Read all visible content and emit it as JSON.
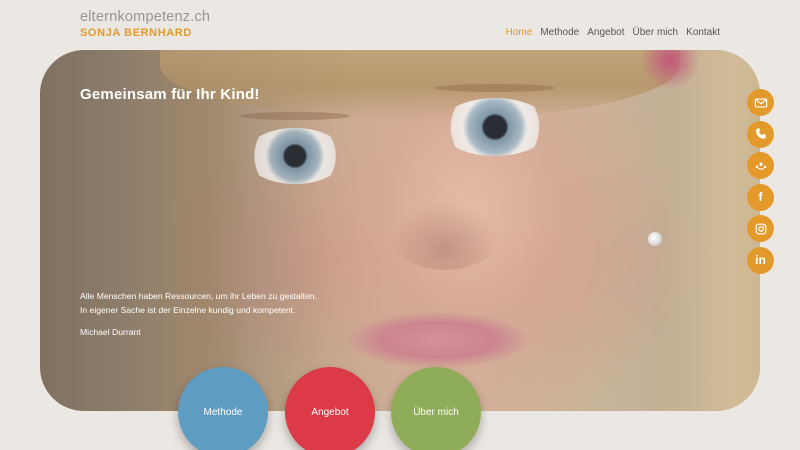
{
  "brand": {
    "domain": "elternkompetenz.ch",
    "name": "SONJA BERNHARD"
  },
  "nav": [
    {
      "label": "Home",
      "active": true
    },
    {
      "label": "Methode",
      "active": false
    },
    {
      "label": "Angebot",
      "active": false
    },
    {
      "label": "Über mich",
      "active": false
    },
    {
      "label": "Kontakt",
      "active": false
    }
  ],
  "hero": {
    "title": "Gemeinsam für Ihr Kind!",
    "quote_line1": "Alle Menschen haben Ressourcen, um ihr Leben zu gestalten.",
    "quote_line2": "In eigener Sache ist der Einzelne kundig und kompetent.",
    "quote_author": "Michael Durrant"
  },
  "social": [
    {
      "icon": "mail-icon"
    },
    {
      "icon": "phone-icon"
    },
    {
      "icon": "network-icon"
    },
    {
      "icon": "facebook-icon",
      "text": "f"
    },
    {
      "icon": "instagram-icon"
    },
    {
      "icon": "linkedin-icon",
      "text": "in"
    }
  ],
  "circles": {
    "methode": {
      "label": "Methode",
      "color": "#5e9dc1"
    },
    "angebot": {
      "label": "Angebot",
      "color": "#dc3a46"
    },
    "ueber": {
      "label": "Über mich",
      "color": "#8fad58"
    }
  },
  "colors": {
    "accent": "#e39a2a",
    "background": "#ebe7e3"
  }
}
